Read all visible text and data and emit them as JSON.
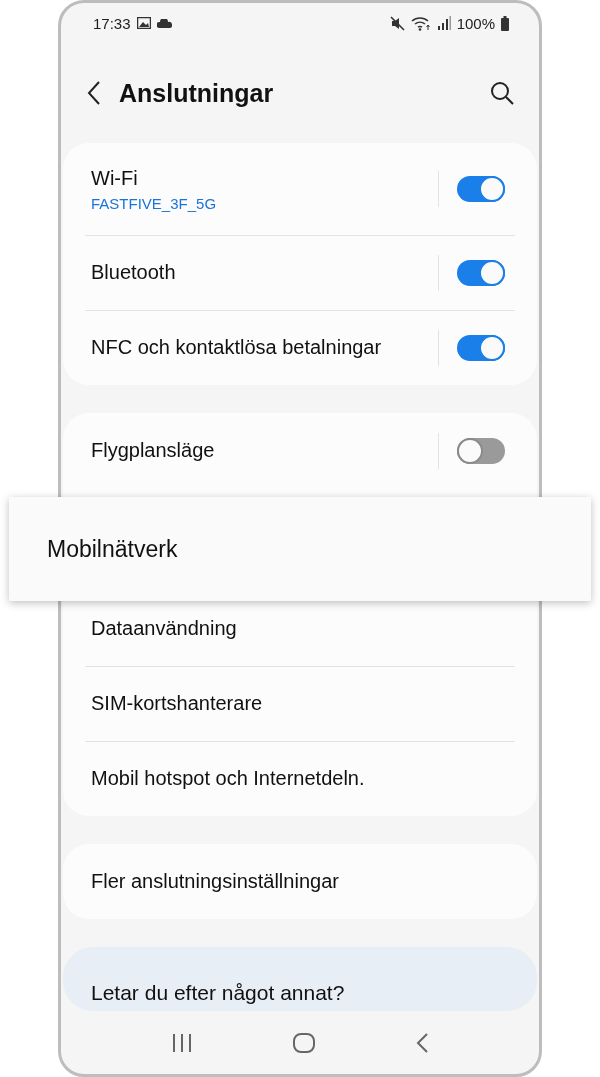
{
  "status_bar": {
    "time": "17:33",
    "battery": "100%"
  },
  "header": {
    "title": "Anslutningar"
  },
  "groups": [
    {
      "items": [
        {
          "kind": "toggle",
          "label": "Wi-Fi",
          "sublabel": "FASTFIVE_3F_5G",
          "on": true
        },
        {
          "kind": "toggle",
          "label": "Bluetooth",
          "on": true
        },
        {
          "kind": "toggle",
          "label": "NFC och kontaktlösa betalningar",
          "on": true
        }
      ]
    },
    {
      "items": [
        {
          "kind": "toggle",
          "label": "Flygplansläge",
          "on": false
        },
        {
          "kind": "highlighted",
          "label": "Mobilnätverk"
        },
        {
          "kind": "link",
          "label": "Dataanvändning"
        },
        {
          "kind": "link",
          "label": "SIM-kortshanterare"
        },
        {
          "kind": "link",
          "label": "Mobil hotspot och Internetdeln."
        }
      ]
    },
    {
      "items": [
        {
          "kind": "link",
          "label": "Fler anslutningsinställningar"
        }
      ]
    }
  ],
  "suggestion": {
    "title": "Letar du efter något annat?"
  }
}
